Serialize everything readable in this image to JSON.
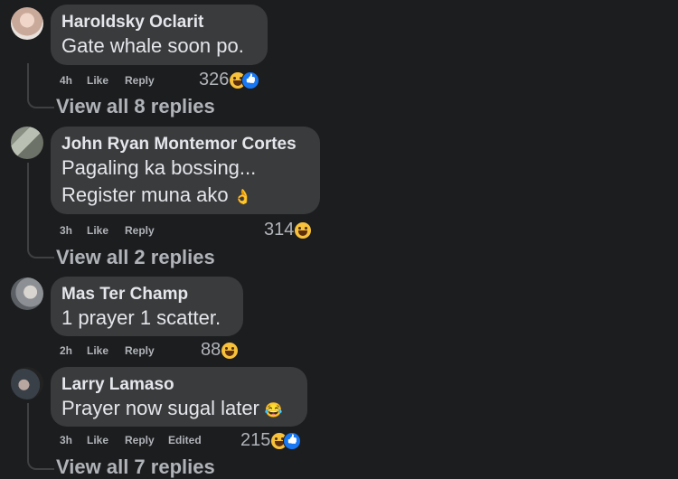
{
  "comments": [
    {
      "author": "Haroldsky Oclarit",
      "lines": [
        "Gate whale soon po."
      ],
      "time": "4h",
      "like": "Like",
      "reply": "Reply",
      "edited": "",
      "reaction_count": "326",
      "reaction_icons": [
        "haha-icon",
        "like-icon"
      ],
      "view_replies": "View all 8 replies"
    },
    {
      "author": "John Ryan Montemor Cortes",
      "lines": [
        "Pagaling ka bossing...",
        "Register muna ako"
      ],
      "inline_emoji": "👌",
      "time": "3h",
      "like": "Like",
      "reply": "Reply",
      "edited": "",
      "reaction_count": "314",
      "reaction_icons": [
        "haha-icon"
      ],
      "view_replies": "View all 2 replies"
    },
    {
      "author": "Mas Ter Champ",
      "lines": [
        "1 prayer 1 scatter."
      ],
      "time": "2h",
      "like": "Like",
      "reply": "Reply",
      "edited": "",
      "reaction_count": "88",
      "reaction_icons": [
        "haha-icon"
      ],
      "view_replies": ""
    },
    {
      "author": "Larry Lamaso",
      "lines": [
        "Prayer now sugal later"
      ],
      "inline_emoji": "😂",
      "time": "3h",
      "like": "Like",
      "reply": "Reply",
      "edited": "Edited",
      "reaction_count": "215",
      "reaction_icons": [
        "haha-icon",
        "like-icon"
      ],
      "view_replies": "View all 7 replies"
    }
  ],
  "colors": {
    "background": "#1c1d1f",
    "bubble": "#3a3b3c",
    "primary_text": "#e4e6eb",
    "secondary_text": "#b0b3b8"
  }
}
